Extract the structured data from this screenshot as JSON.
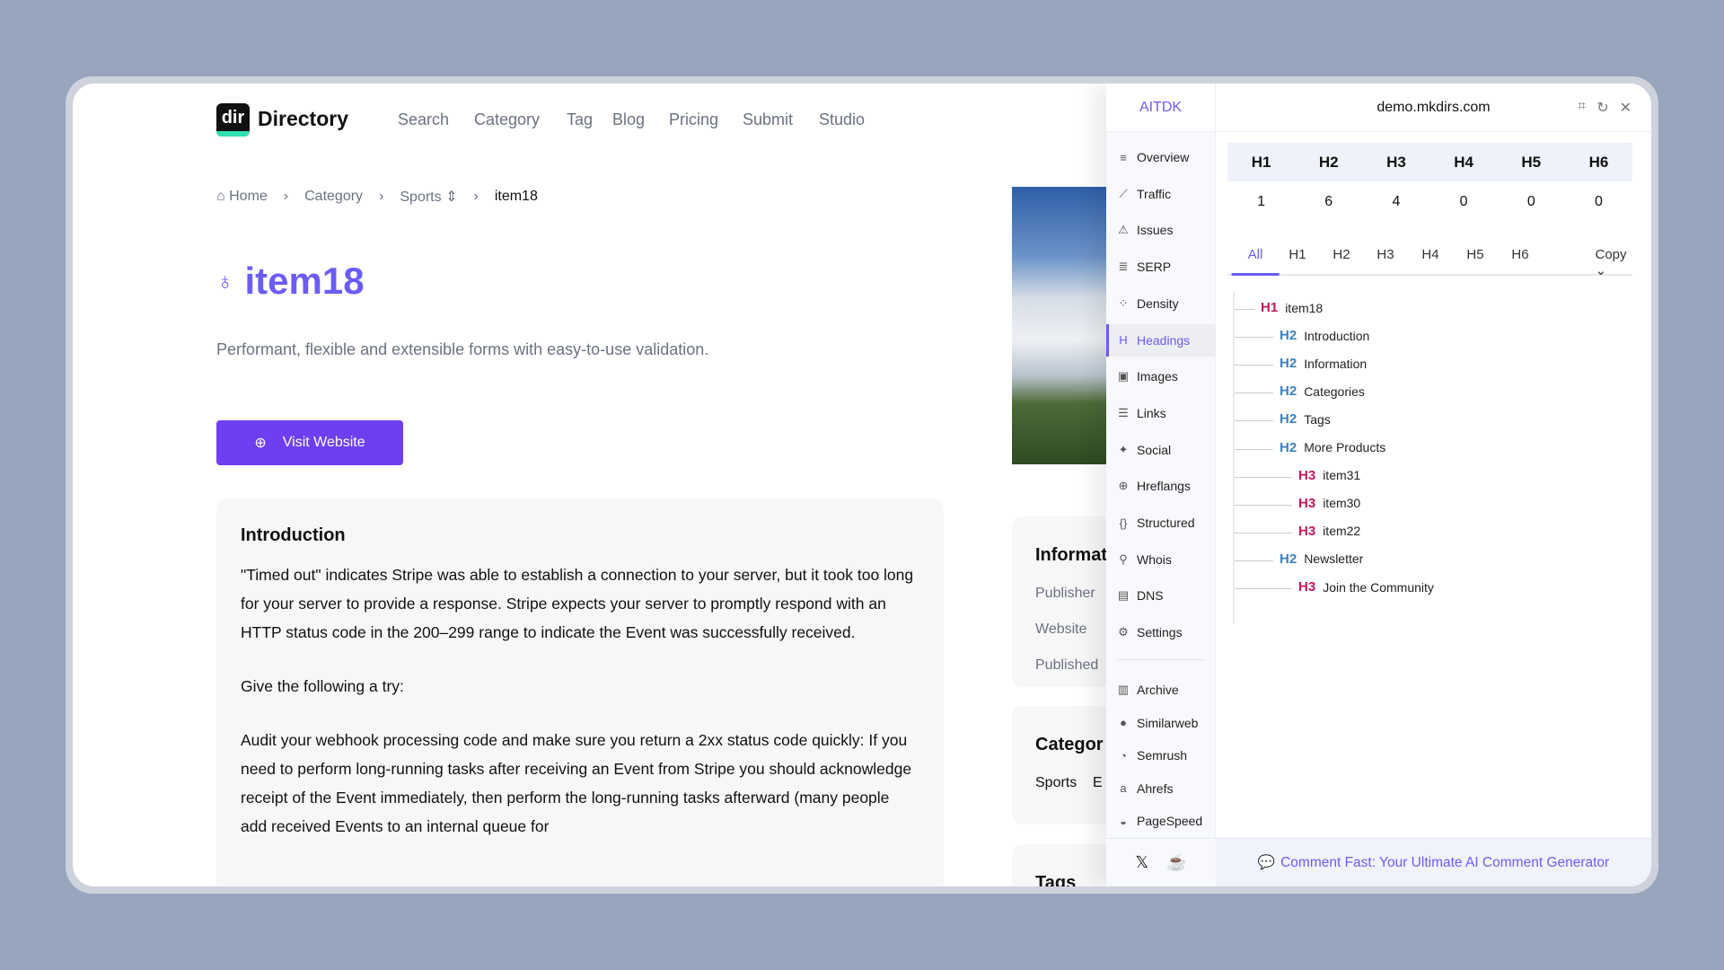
{
  "site": {
    "logo_text": "dir",
    "brand": "Directory",
    "nav": [
      "Search",
      "Category",
      "Tag",
      "Blog",
      "Pricing",
      "Submit",
      "Studio"
    ],
    "breadcrumb": {
      "home": "Home",
      "category": "Category",
      "sub": "Sports",
      "current": "item18"
    },
    "title": "item18",
    "description": "Performant, flexible and extensible forms with easy-to-use validation.",
    "visit_label": "Visit Website",
    "intro": {
      "heading": "Introduction",
      "p1": "\"Timed out\" indicates Stripe was able to establish a connection to your server, but it took too long for your server to provide a response. Stripe expects your server to promptly respond with an HTTP status code in the 200–299 range to indicate the Event was successfully received.",
      "p2": "Give the following a try:",
      "p3": "Audit your webhook processing code and make sure you return a 2xx status code quickly: If you need to perform long-running tasks after receiving an Event from Stripe you should acknowledge receipt of the Event immediately, then perform the long-running tasks afterward (many people add received Events to an internal queue for"
    },
    "info": {
      "heading": "Informat",
      "labels": [
        "Publisher",
        "Website",
        "Published"
      ]
    },
    "categories": {
      "heading": "Categor",
      "items": [
        "Sports",
        "E"
      ]
    },
    "tags": {
      "heading": "Tags"
    }
  },
  "panel": {
    "brand": "AITDK",
    "domain": "demo.mkdirs.com",
    "sidebar": [
      {
        "label": "Overview",
        "icon": "≡"
      },
      {
        "label": "Traffic",
        "icon": "⟋"
      },
      {
        "label": "Issues",
        "icon": "⚠"
      },
      {
        "label": "SERP",
        "icon": "≣"
      },
      {
        "label": "Density",
        "icon": "⁘"
      },
      {
        "label": "Headings",
        "icon": "H"
      },
      {
        "label": "Images",
        "icon": "▣"
      },
      {
        "label": "Links",
        "icon": "☰"
      },
      {
        "label": "Social",
        "icon": "✦"
      },
      {
        "label": "Hreflangs",
        "icon": "⊕"
      },
      {
        "label": "Structured",
        "icon": "{}"
      },
      {
        "label": "Whois",
        "icon": "⚲"
      },
      {
        "label": "DNS",
        "icon": "▤"
      },
      {
        "label": "Settings",
        "icon": "⚙"
      }
    ],
    "external": [
      {
        "label": "Archive",
        "icon": "▥"
      },
      {
        "label": "Similarweb",
        "icon": "●"
      },
      {
        "label": "Semrush",
        "icon": "◔"
      },
      {
        "label": "Ahrefs",
        "icon": "a"
      },
      {
        "label": "PageSpeed",
        "icon": "◒"
      }
    ],
    "active": "Headings",
    "counts": {
      "headers": [
        "H1",
        "H2",
        "H3",
        "H4",
        "H5",
        "H6"
      ],
      "values": [
        "1",
        "6",
        "4",
        "0",
        "0",
        "0"
      ]
    },
    "tabs": [
      "All",
      "H1",
      "H2",
      "H3",
      "H4",
      "H5",
      "H6"
    ],
    "copy_label": "Copy",
    "tree": [
      {
        "level": "H1",
        "text": "item18"
      },
      {
        "level": "H2",
        "text": "Introduction"
      },
      {
        "level": "H2",
        "text": "Information"
      },
      {
        "level": "H2",
        "text": "Categories"
      },
      {
        "level": "H2",
        "text": "Tags"
      },
      {
        "level": "H2",
        "text": "More Products"
      },
      {
        "level": "H3",
        "text": "item31"
      },
      {
        "level": "H3",
        "text": "item30"
      },
      {
        "level": "H3",
        "text": "item22"
      },
      {
        "level": "H2",
        "text": "Newsletter"
      },
      {
        "level": "H3",
        "text": "Join the Community"
      }
    ],
    "promo": "Comment Fast: Your Ultimate AI Comment Generator",
    "colors": {
      "accent": "#6b5cf6",
      "h1": "#c2185b",
      "h2": "#3b82c4",
      "h3": "#c2185b"
    }
  }
}
